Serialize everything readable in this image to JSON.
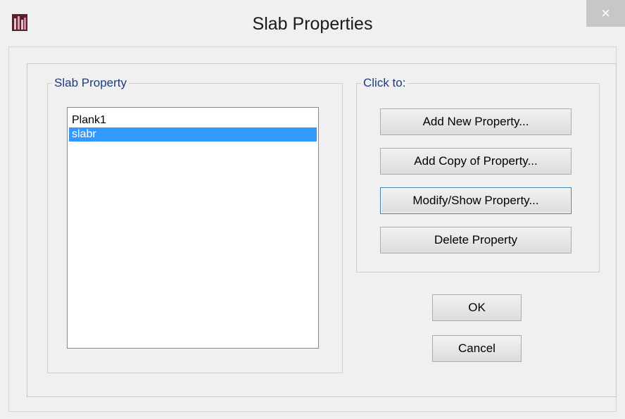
{
  "window": {
    "title": "Slab Properties",
    "close_glyph": "×",
    "app_icon": "etabs-app-icon"
  },
  "slab_property": {
    "legend": "Slab Property",
    "items": [
      {
        "label": "Plank1",
        "selected": false
      },
      {
        "label": "slabr",
        "selected": true
      }
    ]
  },
  "click_to": {
    "legend": "Click to:",
    "add_new": "Add New Property...",
    "add_copy": "Add Copy of Property...",
    "modify_show": "Modify/Show Property...",
    "delete": "Delete Property"
  },
  "footer": {
    "ok": "OK",
    "cancel": "Cancel"
  },
  "colors": {
    "selection": "#3399ff",
    "legend_text": "#1f3a7a",
    "close_button": "#c7c7c7"
  }
}
